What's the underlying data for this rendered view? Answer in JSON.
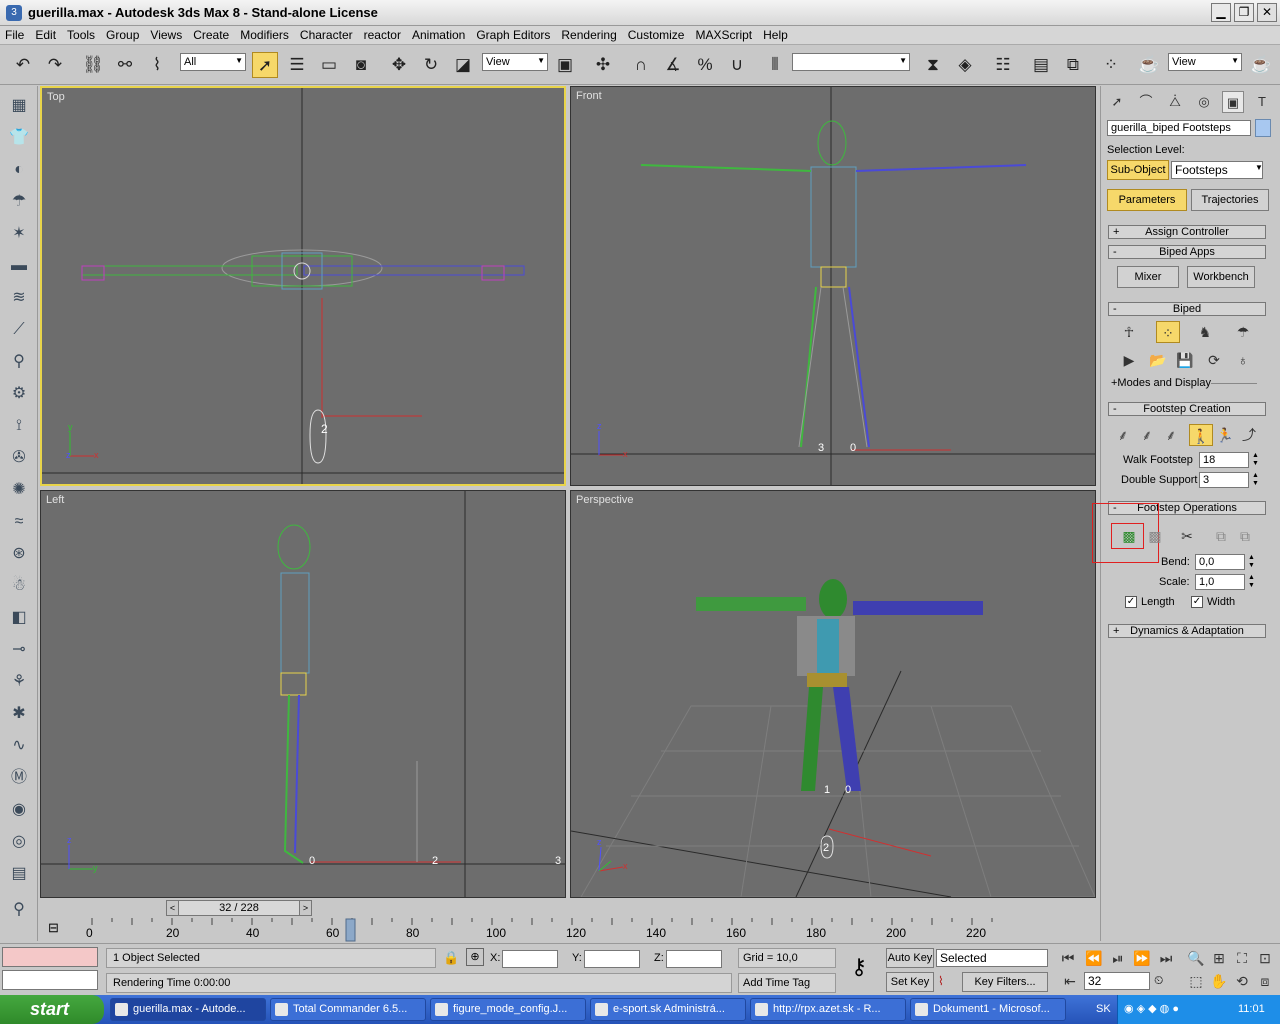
{
  "window": {
    "title": "guerilla.max - Autodesk 3ds Max 8 - Stand-alone License",
    "minimize": "▁",
    "maximize": "❐",
    "close": "✕"
  },
  "menu": [
    "File",
    "Edit",
    "Tools",
    "Group",
    "Views",
    "Create",
    "Modifiers",
    "Character",
    "reactor",
    "Animation",
    "Graph Editors",
    "Rendering",
    "Customize",
    "MAXScript",
    "Help"
  ],
  "toolbar": {
    "selection_filter": "All",
    "ref_coord": "View",
    "named_selection": "",
    "render_view": "View",
    "snap_angle": "3",
    "percent": "%"
  },
  "viewports": {
    "top": "Top",
    "front": "Front",
    "left": "Left",
    "perspective": "Perspective"
  },
  "viewport_marks": {
    "top_footstep": "2",
    "front_footsteps_a": "3",
    "front_footsteps_b": "0",
    "left_foot_a": "0",
    "left_foot_b": "2",
    "left_foot_c": "3",
    "persp_foot_a": "1",
    "persp_foot_b": "0",
    "persp_foot_c": "2"
  },
  "axes": {
    "x": "x",
    "y": "y",
    "z": "z"
  },
  "command_panel": {
    "object_name": "guerilla_biped Footsteps",
    "selection_level_label": "Selection Level:",
    "sub_object": "Sub-Object",
    "level_value": "Footsteps",
    "parameters_tab": "Parameters",
    "trajectories_tab": "Trajectories",
    "assign_controller": "Assign Controller",
    "biped_apps": "Biped Apps",
    "mixer": "Mixer",
    "workbench": "Workbench",
    "biped": "Biped",
    "modes_display": "+Modes and Display",
    "footstep_creation": "Footstep Creation",
    "walk_footstep_label": "Walk Footstep",
    "walk_footstep_value": "18",
    "double_support_label": "Double Support",
    "double_support_value": "3",
    "footstep_operations": "Footstep Operations",
    "bend_label": "Bend:",
    "bend_value": "0,0",
    "scale_label": "Scale:",
    "scale_value": "1,0",
    "length_label": "Length",
    "width_label": "Width",
    "dynamics": "Dynamics & Adaptation",
    "plus": "+",
    "minus": "-"
  },
  "timeline": {
    "frame_display": "32 / 228",
    "ticks": [
      "0",
      "20",
      "40",
      "60",
      "80",
      "100",
      "120",
      "140",
      "160",
      "180",
      "200",
      "220"
    ],
    "frame_fraction": 0.14
  },
  "status": {
    "objects_selected": "1 Object Selected",
    "rendering_time": "Rendering Time  0:00:00",
    "x_label": "X:",
    "y_label": "Y:",
    "z_label": "Z:",
    "grid": "Grid = 10,0",
    "add_time_tag": "Add Time Tag",
    "auto_key": "Auto Key",
    "selected": "Selected",
    "set_key": "Set Key",
    "key_filters": "Key Filters...",
    "current_frame": "32"
  },
  "taskbar": {
    "start": "start",
    "tasks": [
      "guerilla.max - Autode...",
      "Total Commander 6.5...",
      "figure_mode_config.J...",
      "e-sport.sk Administrá...",
      "http://rpx.azet.sk - R...",
      "Dokument1 - Microsof..."
    ],
    "lang": "SK",
    "clock": "11:01"
  }
}
